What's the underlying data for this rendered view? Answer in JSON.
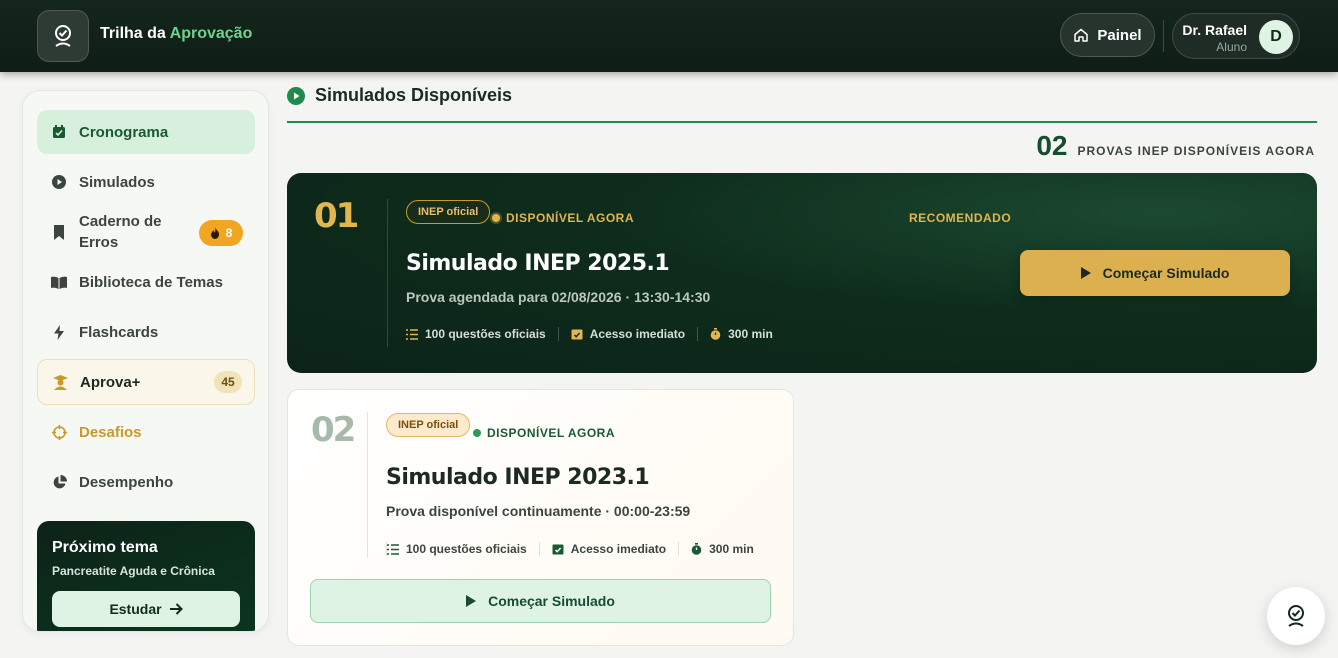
{
  "header": {
    "brand_prefix": "Trilha da",
    "brand_accent": "Aprovação",
    "painel_label": "Painel",
    "user_name": "Dr. Rafael",
    "user_role": "Aluno",
    "avatar_initial": "D"
  },
  "sidebar": {
    "items": [
      {
        "label": "Cronograma",
        "icon": "calendar-check-icon",
        "active": true
      },
      {
        "label": "Simulados",
        "icon": "play-circle-icon"
      },
      {
        "label": "Caderno de Erros",
        "icon": "bookmark-icon",
        "badge": "8"
      },
      {
        "label": "Biblioteca de Temas",
        "icon": "book-open-icon"
      },
      {
        "label": "Flashcards",
        "icon": "bolt-icon"
      },
      {
        "label": "Aprova+",
        "icon": "graduate-icon",
        "badge": "45"
      },
      {
        "label": "Desafios",
        "icon": "crosshair-icon"
      },
      {
        "label": "Desempenho",
        "icon": "pie-chart-icon"
      }
    ],
    "next_topic": {
      "title": "Próximo tema",
      "subtitle": "Pancreatite Aguda e Crônica",
      "button_label": "Estudar"
    }
  },
  "main": {
    "section_title": "Simulados Disponíveis",
    "count": "02",
    "count_label": "PROVAS INEP DISPONÍVEIS AGORA",
    "cards": [
      {
        "number": "01",
        "tag": "INEP oficial",
        "status": "DISPONÍVEL AGORA",
        "recommended": "RECOMENDADO",
        "title": "Simulado INEP 2025.1",
        "subtitle": "Prova agendada para 02/08/2026 · 13:30-14:30",
        "meta_questions": "100 questões oficiais",
        "meta_access": "Acesso imediato",
        "meta_time": "300 min",
        "button_label": "Começar Simulado"
      },
      {
        "number": "02",
        "tag": "INEP oficial",
        "status": "DISPONÍVEL AGORA",
        "title": "Simulado INEP 2023.1",
        "subtitle": "Prova disponível continuamente · 00:00-23:59",
        "meta_questions": "100 questões oficiais",
        "meta_access": "Acesso imediato",
        "meta_time": "300 min",
        "button_label": "Começar Simulado"
      }
    ]
  },
  "colors": {
    "brand_green": "#1a5a33",
    "accent_green": "#6fd38d",
    "gold": "#ddb04f",
    "dark_card": "#0e2c1c"
  }
}
